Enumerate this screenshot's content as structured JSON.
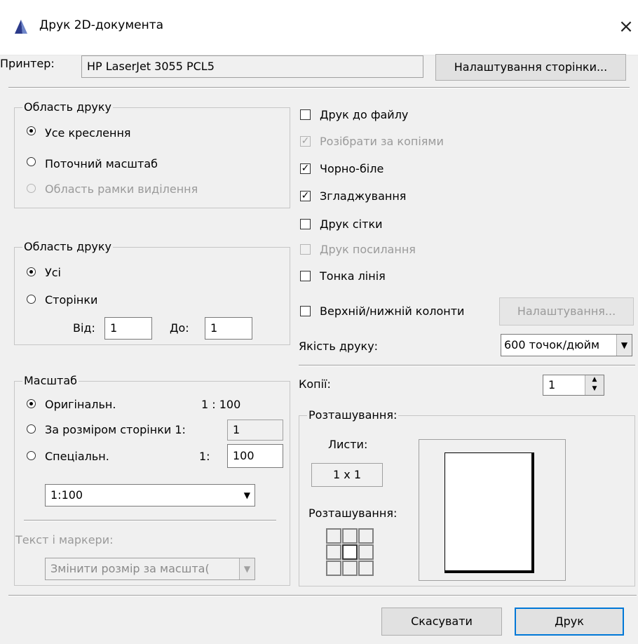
{
  "title_bar": {
    "title": "Друк 2D-документа",
    "close_glyph": "×",
    "icon": "app-logo-icon"
  },
  "printer": {
    "label": "Принтер:",
    "name": "HP LaserJet 3055 PCL5",
    "page_setup_button": "Налаштування сторінки..."
  },
  "print_area": {
    "legend": "Область друку",
    "options": [
      {
        "label": "Усе креслення",
        "selected": true,
        "enabled": true
      },
      {
        "label": "Поточний масштаб",
        "selected": false,
        "enabled": true
      },
      {
        "label": "Область рамки виділення",
        "selected": false,
        "enabled": false
      }
    ]
  },
  "page_range": {
    "legend": "Область друку",
    "options": [
      {
        "label": "Усі",
        "selected": true
      },
      {
        "label": "Сторінки",
        "selected": false
      }
    ],
    "from_label": "Від:",
    "from_value": "1",
    "to_label": "До:",
    "to_value": "1"
  },
  "scale": {
    "legend": "Масштаб",
    "original_label": "Оригінальн.",
    "original_value": "1 : 100",
    "fit_label": "За розміром сторінки 1:",
    "fit_value": "1",
    "custom_label": "Спеціальн.",
    "custom_prefix": "1:",
    "custom_value": "100",
    "preset_value": "1:100",
    "text_markers_label": "Текст і маркери:",
    "text_markers_value": "Змінити розмір за масшта("
  },
  "options": [
    {
      "label": "Друк до файлу",
      "checked": false,
      "enabled": true
    },
    {
      "label": "Розібрати за копіями",
      "checked": true,
      "enabled": false
    },
    {
      "label": "Чорно-біле",
      "checked": true,
      "enabled": true
    },
    {
      "label": "Згладжування",
      "checked": true,
      "enabled": true
    },
    {
      "label": "Друк сітки",
      "checked": false,
      "enabled": true
    },
    {
      "label": "Друк посилання",
      "checked": false,
      "enabled": false
    },
    {
      "label": "Тонка лінія",
      "checked": false,
      "enabled": true
    },
    {
      "label": "Верхній/нижній колонти",
      "checked": false,
      "enabled": true
    }
  ],
  "header_footer_button": "Налаштування...",
  "quality": {
    "label": "Якість друку:",
    "value": "600 точок/дюйм"
  },
  "copies": {
    "label": "Копії:",
    "value": "1"
  },
  "layout": {
    "legend": "Розташування:",
    "sheets_label": "Листи:",
    "sheets_value": "1 x 1",
    "placement_label": "Розташування:"
  },
  "buttons": {
    "cancel": "Скасувати",
    "print": "Друк"
  },
  "colors": {
    "accent": "#0078d7",
    "logo": "#2b3a8a"
  }
}
